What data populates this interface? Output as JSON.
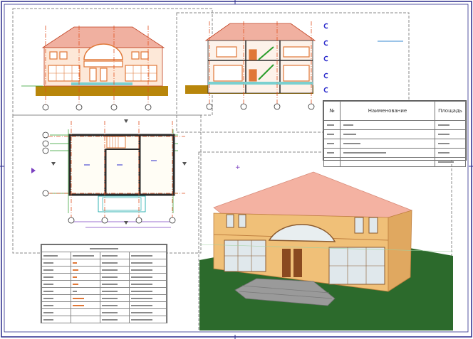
{
  "schedule": {
    "col_no": "№",
    "col_name": "Наименование",
    "col_area": "Площадь",
    "rows": 5
  },
  "legend": {
    "rows": 11
  },
  "colors": {
    "frame": "#2b2b8c",
    "roof_elev": "#e8a088",
    "brick": "#e07838",
    "wall_3d": "#f0c078",
    "roof_3d": "#f2b0a0",
    "grass": "#2c6a2c",
    "axis": "#e05020",
    "dim": "#00a0a0"
  }
}
